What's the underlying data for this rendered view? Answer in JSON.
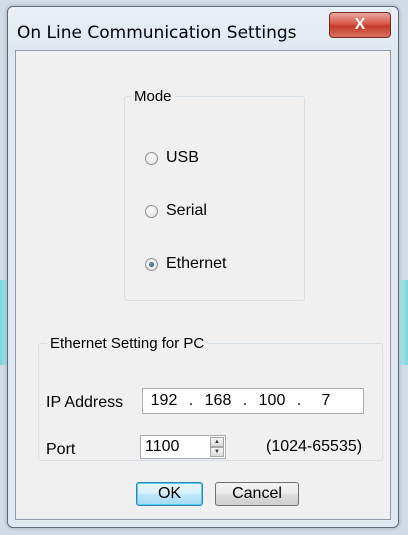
{
  "dialog": {
    "title": "On Line Communication Settings",
    "close_glyph": "X"
  },
  "mode": {
    "legend": "Mode",
    "options": [
      {
        "label": "USB",
        "checked": false
      },
      {
        "label": "Serial",
        "checked": false
      },
      {
        "label": "Ethernet",
        "checked": true
      }
    ]
  },
  "ethernet": {
    "legend": "Ethernet Setting for PC",
    "ip_label": "IP Address",
    "ip": [
      "192",
      "168",
      "100",
      "7"
    ],
    "port_label": "Port",
    "port_value": "1100",
    "port_range": "(1024-65535)"
  },
  "buttons": {
    "ok": "OK",
    "cancel": "Cancel"
  }
}
